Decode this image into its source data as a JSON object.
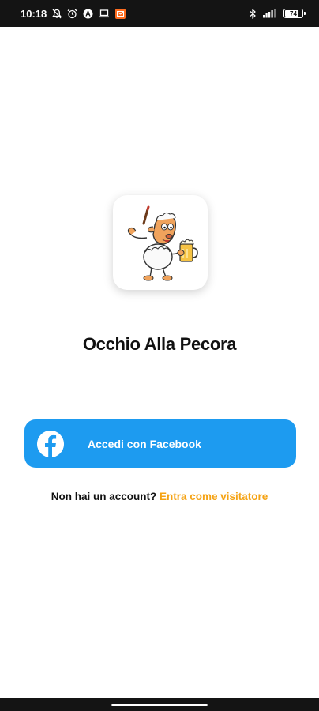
{
  "status_bar": {
    "time": "10:18",
    "battery_level": "74",
    "icons": [
      "bell-off-icon",
      "alarm-icon",
      "a-circle-icon",
      "laptop-icon",
      "mail-notification-icon",
      "bluetooth-icon",
      "signal-icon",
      "battery-icon"
    ]
  },
  "app": {
    "title": "Occhio Alla Pecora",
    "logo": "sheep-with-beer-logo"
  },
  "login": {
    "facebook_button_label": "Accedi con Facebook",
    "no_account_text": "Non hai un account?",
    "guest_link": "Entra come visitatore"
  },
  "colors": {
    "facebook_button": "#1d9bf0",
    "guest_link": "#f5a314",
    "status_bar": "#141414"
  }
}
